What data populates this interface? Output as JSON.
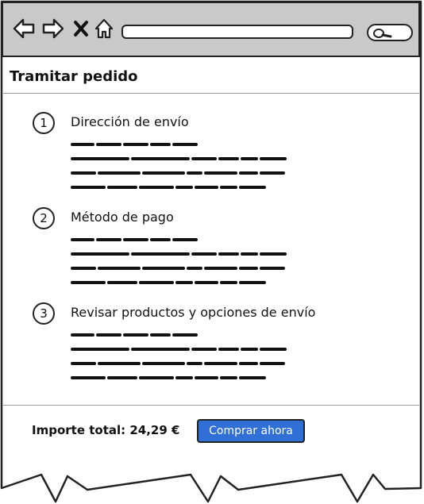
{
  "page": {
    "title": "Tramitar pedido"
  },
  "browser": {
    "url_value": ""
  },
  "steps": [
    {
      "number": "1",
      "title": "Dirección de envío"
    },
    {
      "number": "2",
      "title": "Método de pago"
    },
    {
      "number": "3",
      "title": "Revisar productos y opciones de envío"
    }
  ],
  "footer": {
    "total_label": "Importe total: 24,29 €",
    "buy_label": "Comprar ahora"
  },
  "colors": {
    "toolbar_bg": "#c9c9c9",
    "button_accent": "#2f6fd6"
  },
  "icons": [
    "back-arrow-icon",
    "forward-arrow-icon",
    "close-icon",
    "home-icon",
    "search-icon"
  ]
}
